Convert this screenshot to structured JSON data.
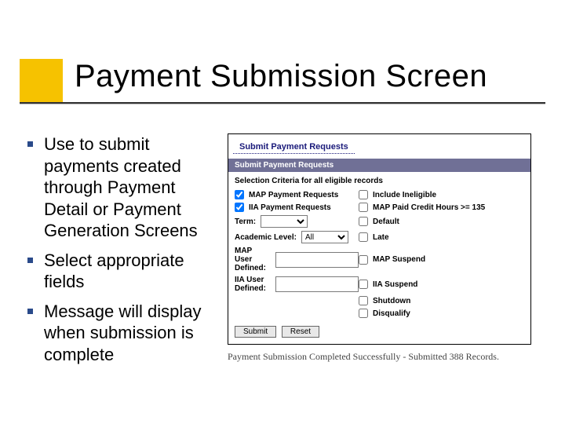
{
  "title": "Payment Submission Screen",
  "bullets": [
    "Use to submit payments created through Payment Detail or Payment Generation Screens",
    "Select appropriate fields",
    "Message will display when submission is complete"
  ],
  "panel": {
    "heading": "Submit Payment Requests",
    "bar": "Submit Payment Requests",
    "subheading": "Selection Criteria for all eligible records",
    "row1": {
      "left_checked": true,
      "left_label": "MAP Payment Requests",
      "right_checked": false,
      "right_label": "Include Ineligible"
    },
    "row2": {
      "left_checked": true,
      "left_label": "IIA Payment Requests",
      "right_checked": false,
      "right_label": "MAP Paid Credit Hours >= 135"
    },
    "row3": {
      "left_label": "Term:",
      "select_value": "",
      "right_checked": false,
      "right_label": "Default"
    },
    "row4": {
      "left_label": "Academic Level:",
      "select_value": "All",
      "right_checked": false,
      "right_label": "Late"
    },
    "row5": {
      "left_label": "MAP User Defined:",
      "value": "",
      "right_checked": false,
      "right_label": "MAP Suspend"
    },
    "row6": {
      "left_label": "IIA User Defined:",
      "value": "",
      "right_checked": false,
      "right_label": "IIA Suspend"
    },
    "row7": {
      "right_checked": false,
      "right_label": "Shutdown"
    },
    "row8": {
      "right_checked": false,
      "right_label": "Disqualify"
    },
    "buttons": {
      "submit": "Submit",
      "reset": "Reset"
    }
  },
  "message": "Payment Submission Completed Successfully - Submitted 388 Records."
}
